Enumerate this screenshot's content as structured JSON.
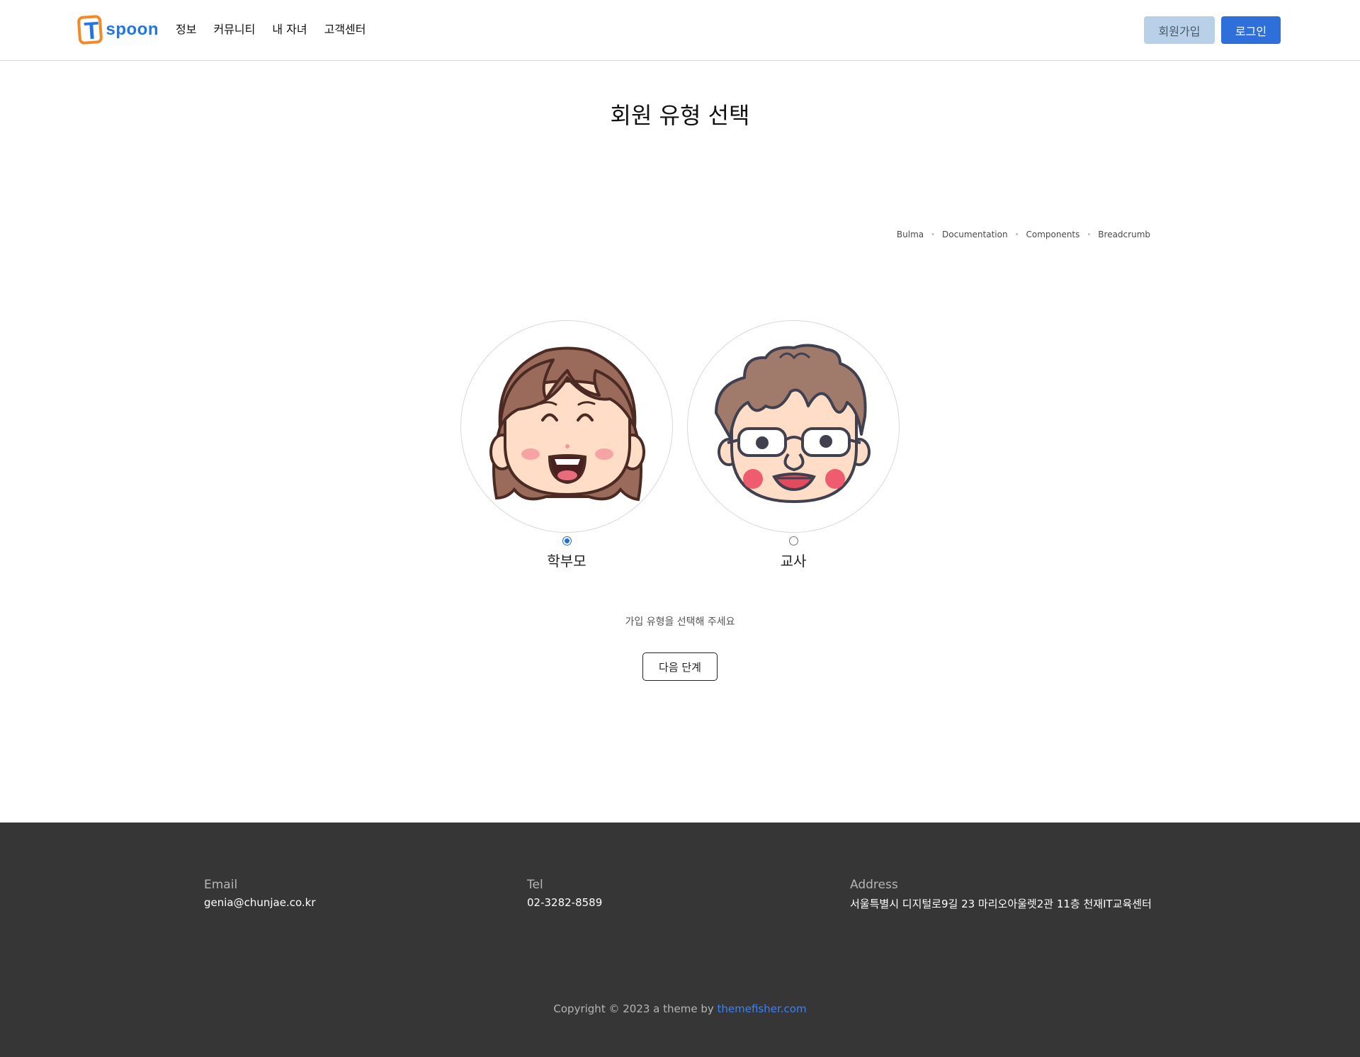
{
  "header": {
    "logo_text": "spoon",
    "logo_letter": "T",
    "nav": [
      "정보",
      "커뮤니티",
      "내 자녀",
      "고객센터"
    ],
    "signup_label": "회원가입",
    "login_label": "로그인"
  },
  "main": {
    "title": "회원 유형 선택",
    "breadcrumb": [
      "Bulma",
      "Documentation",
      "Components",
      "Breadcrumb"
    ],
    "choices": [
      {
        "label": "학부모",
        "selected": true,
        "icon": "parent-avatar-icon"
      },
      {
        "label": "교사",
        "selected": false,
        "icon": "teacher-avatar-icon"
      }
    ],
    "hint": "가입 유형을 선택해 주세요",
    "next_label": "다음 단계"
  },
  "footer": {
    "email_label": "Email",
    "email_value": "genia@chunjae.co.kr",
    "tel_label": "Tel",
    "tel_value": "02-3282-8589",
    "address_label": "Address",
    "address_value": "서울특별시 디지털로9길 23 마리오아울렛2관 11층 천재IT교육센터",
    "copyright_text": "Copyright © 2023 a theme by ",
    "copyright_link": "themefisher.com"
  },
  "colors": {
    "primary": "#2f6fd9",
    "signup_bg": "#b8d1e8",
    "footer_bg": "#363636",
    "logo_orange": "#f28a28"
  }
}
